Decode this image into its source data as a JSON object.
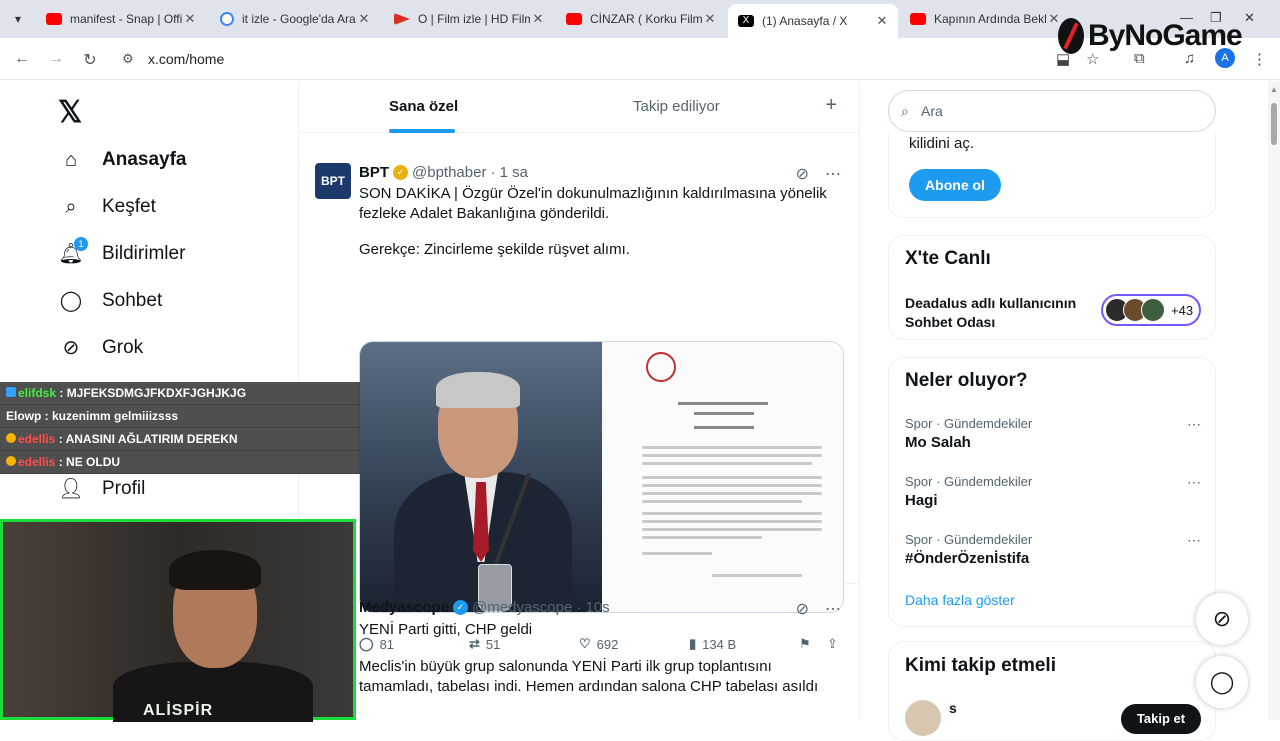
{
  "browser": {
    "tabs": [
      {
        "title": "manifest - Snap | Offi",
        "color": "#ff0000"
      },
      {
        "title": "it izle - Google'da Ara",
        "color": "#4285f4"
      },
      {
        "title": "O | Film izle | HD Film",
        "color": "#d93025"
      },
      {
        "title": "CİNZAR ( Korku Filmi",
        "color": "#ff0000"
      },
      {
        "title": "(1) Anasayfa / X",
        "color": "#000000"
      },
      {
        "title": "Kapının Ardında Bekl",
        "color": "#ff0000"
      }
    ],
    "url": "x.com/home",
    "profile_initial": "A",
    "logo_text": "ByNoGame"
  },
  "leftnav": {
    "items": [
      {
        "label": "Anasayfa",
        "icon": "home-icon"
      },
      {
        "label": "Keşfet",
        "icon": "search-icon"
      },
      {
        "label": "Bildirimler",
        "icon": "bell-icon",
        "badge": "1"
      },
      {
        "label": "Sohbet",
        "icon": "chat-icon"
      },
      {
        "label": "Grok",
        "icon": "grok-icon"
      },
      {
        "label": "Profil",
        "icon": "person-icon"
      }
    ]
  },
  "feed": {
    "tabs": [
      "Sana özel",
      "Takip ediliyor"
    ],
    "tweets": [
      {
        "avatar": "BPT",
        "name": "BPT",
        "handle": "@bpthaber",
        "time": "· 1 sa",
        "badge_color": "#e8b10c",
        "text1": "SON DAKİKA | Özgür Özel'in dokunulmazlığının kaldırılmasına yönelik fezleke Adalet Bakanlığına gönderildi.",
        "text2": "Gerekçe: Zincirleme şekilde rüşvet alımı.",
        "replies": "81",
        "reposts": "51",
        "likes": "692",
        "views": "134 B"
      },
      {
        "name": "Medyascope",
        "handle": "@medyascope",
        "time": "· 10s",
        "badge_color": "#1d9bf0",
        "text1": "YENİ Parti gitti, CHP geldi",
        "text2": "Meclis'in büyük grup salonunda YENİ Parti ilk grup toplantısını tamamladı, tabelası indi. Hemen ardından salona CHP tabelası asıldı"
      }
    ]
  },
  "right": {
    "search_placeholder": "Ara",
    "premium_text": "kilidini aç.",
    "subscribe_label": "Abone ol",
    "live_title": "X'te Canlı",
    "live_text": "Deadalus adlı kullanıcının Sohbet Odası",
    "live_count": "+43",
    "trends_title": "Neler oluyor?",
    "trends": [
      {
        "context": "Spor · Gündemdekiler",
        "title": "Mo Salah"
      },
      {
        "context": "Spor · Gündemdekiler",
        "title": "Hagi"
      },
      {
        "context": "Spor · Gündemdekiler",
        "title": "#ÖnderÖzenİstifa"
      }
    ],
    "show_more": "Daha fazla göster",
    "follow_title": "Kimi takip etmeli",
    "follow_name": "s",
    "follow_label": "Takip et"
  },
  "stream": {
    "chat": [
      {
        "user": "elifdsk",
        "msg": ": MJFEKSDMGJFKDXFJGHJKJG"
      },
      {
        "user": "",
        "msg": "Elowp : kuzenimm gelmiiizsss"
      },
      {
        "user": "edellis",
        "msg": ": ANASINI AĞLATIRIM DEREKN"
      },
      {
        "user": "edellis",
        "msg": ": NE OLDU"
      }
    ],
    "streamer_name": "ALİSPİR"
  }
}
